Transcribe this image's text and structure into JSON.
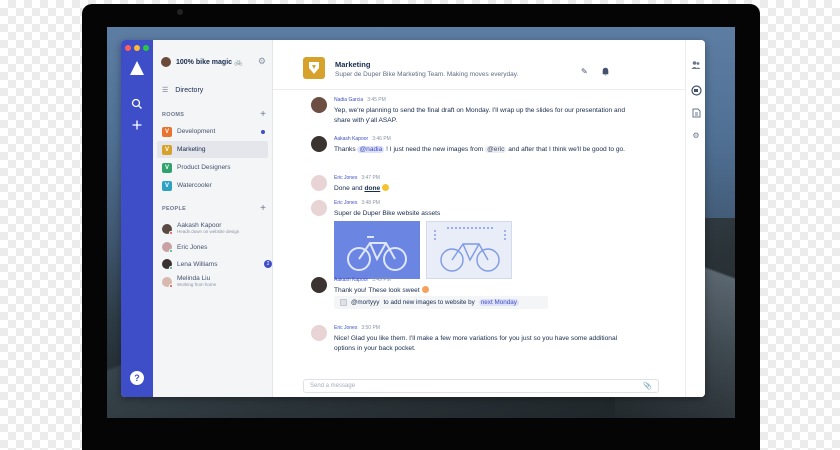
{
  "team": {
    "name": "100% bike magic 🚲"
  },
  "directory": {
    "label": "Directory"
  },
  "rooms": {
    "section_label": "ROOMS",
    "items": [
      {
        "label": "Development",
        "color": "#e8742f",
        "unread": true
      },
      {
        "label": "Marketing",
        "color": "#d6a22b",
        "active": true
      },
      {
        "label": "Product Designers",
        "color": "#2fa36b"
      },
      {
        "label": "Watercooler",
        "color": "#2fa1c4"
      }
    ]
  },
  "people": {
    "section_label": "PEOPLE",
    "items": [
      {
        "name": "Aakash Kapoor",
        "status": "Heads down on website design",
        "status_color": "#e5493a"
      },
      {
        "name": "Eric Jones",
        "status": "",
        "status_color": "#36b37e"
      },
      {
        "name": "Lena Williams",
        "status": "",
        "status_color": "#36b37e",
        "badge": "2"
      },
      {
        "name": "Melinda Liu",
        "status": "Working from home",
        "status_color": "#e5493a"
      }
    ]
  },
  "header": {
    "title": "Marketing",
    "subtitle": "Super de Duper Bike Marketing Team. Making moves everyday."
  },
  "messages": [
    {
      "author": "Nadia Garcia",
      "time": "3:45 PM",
      "text": "Yep, we're planning to send the final draft on Monday. I'll wrap up the slides for our presentation and share with y'all ASAP."
    },
    {
      "author": "Aakash Kapoor",
      "time": "3:46 PM",
      "text_parts": [
        "Thanks ",
        "@nadia",
        " ! I just need the new images from ",
        "@eric",
        " and after that I think we'll be good to go."
      ]
    },
    {
      "author": "Eric Jones",
      "time": "3:47 PM",
      "text_parts": [
        "Done and ",
        "done"
      ]
    },
    {
      "author": "Eric Jones",
      "time": "3:48 PM",
      "text": "Super de Duper Bike website assets"
    },
    {
      "author": "Aakash Kapoor",
      "time": "3:49 PM",
      "text": "Thank you! These look sweet",
      "task_parts": [
        "@mortyyy",
        " to add new images to website by ",
        "next Monday"
      ]
    },
    {
      "author": "Eric Jones",
      "time": "3:50 PM",
      "text": "Nice! Glad you like them.  I'll make a few more variations for you just so you have some additional options in your back pocket."
    }
  ],
  "composer": {
    "placeholder": "Send a message"
  },
  "colors": {
    "accent": "#3e4ec9",
    "rail": "#3e4ec9"
  }
}
